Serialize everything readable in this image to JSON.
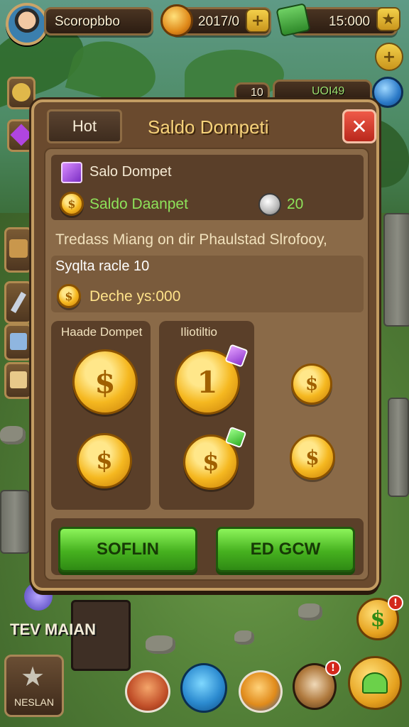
{
  "player": {
    "name": "Scoropbbo"
  },
  "hud": {
    "currency_1": "2017/0",
    "currency_2": "15:000",
    "counter_small": "10",
    "counter_right": "UOI49"
  },
  "panel": {
    "tab_label": "Hot",
    "title": "Saldo Dompeti",
    "close_icon": "close-icon",
    "info": {
      "gem_label": "Salo Dompet",
      "coin_label": "Saldo Daanpet",
      "coin_value": "20"
    },
    "description": "Tredass Miang on dir Phaulstad Slrofooy,",
    "sub": {
      "title": "Syqlta racle 10",
      "coin_text": "Deche ys:000"
    },
    "cards": [
      {
        "label": "Haade Dompet"
      },
      {
        "label": "Iliotiltio"
      }
    ],
    "buttons": {
      "left": "SOFLIN",
      "right": "ED GCW"
    }
  },
  "side": {
    "bottom_left_text": "TEV MAIAN",
    "bottom_left_button": "NESLAN"
  },
  "bottom_nav": {
    "notifications": [
      "!",
      "!"
    ]
  },
  "colors": {
    "panel_wood": "#6a4a2e",
    "title_gold": "#f6d27a",
    "button_green": "#46b11f",
    "close_red": "#b9281c"
  }
}
